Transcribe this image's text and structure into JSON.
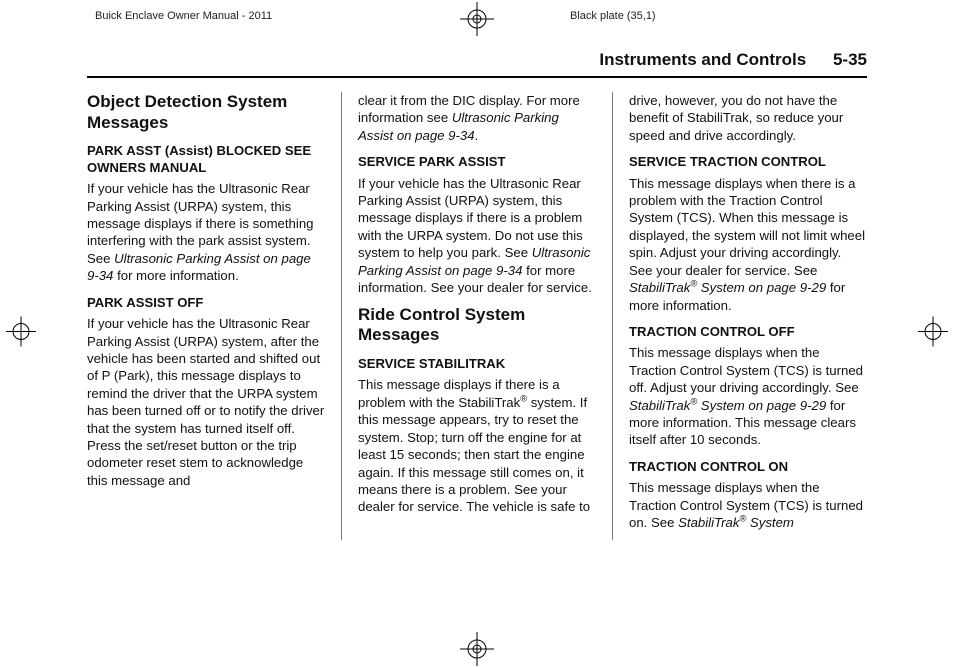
{
  "meta": {
    "manual": "Buick Enclave Owner Manual - 2011",
    "plate": "Black plate (35,1)"
  },
  "header": {
    "chapter": "Instruments and Controls",
    "page": "5-35"
  },
  "col1": {
    "h_object": "Object Detection System Messages",
    "m1_title": "PARK ASST (Assist) BLOCKED SEE OWNERS MANUAL",
    "m1_p_a": "If your vehicle has the Ultrasonic Rear Parking Assist (URPA) system, this message displays if there is something interfering with the park assist system. See ",
    "m1_ref": "Ultrasonic Parking Assist on page 9‑34",
    "m1_p_b": " for more information.",
    "m2_title": "PARK ASSIST OFF",
    "m2_p": "If your vehicle has the Ultrasonic Rear Parking Assist (URPA) system, after the vehicle has been started and shifted out of P (Park), this message displays to remind the driver that the URPA system has been turned off or to notify the driver that the system has turned itself off. Press the set/reset button or the trip odometer reset stem to acknowledge this message and"
  },
  "col2": {
    "cont_a": "clear it from the DIC display. For more information see ",
    "cont_ref": "Ultrasonic Parking Assist on page 9‑34",
    "cont_b": ".",
    "m3_title": "SERVICE PARK ASSIST",
    "m3_p_a": "If your vehicle has the Ultrasonic Rear Parking Assist (URPA) system, this message displays if there is a problem with the URPA system. Do not use this system to help you park. See ",
    "m3_ref": "Ultrasonic Parking Assist on page 9‑34",
    "m3_p_b": " for more information. See your dealer for service.",
    "h_ride": "Ride Control System Messages",
    "m4_title": "SERVICE STABILITRAK",
    "m4_p_a": "This message displays if there is a problem with the StabiliTrak",
    "m4_reg": "®",
    "m4_p_b": " system. If this message appears, try to reset the system. Stop; turn off the engine for at least 15 seconds; then start the engine again. If this message still comes on, it means there is a problem. See your dealer for service. The vehicle is safe to"
  },
  "col3": {
    "cont": "drive, however, you do not have the benefit of StabiliTrak, so reduce your speed and drive accordingly.",
    "m5_title": "SERVICE TRACTION CONTROL",
    "m5_p_a": "This message displays when there is a problem with the Traction Control System (TCS). When this message is displayed, the system will not limit wheel spin. Adjust your driving accordingly. See your dealer for service. See ",
    "m5_ref": "StabiliTrak",
    "m5_reg": "®",
    "m5_ref2": " System on page 9‑29",
    "m5_p_b": " for more information.",
    "m6_title": "TRACTION CONTROL OFF",
    "m6_p_a": "This message displays when the Traction Control System (TCS) is turned off. Adjust your driving accordingly. See ",
    "m6_ref": "StabiliTrak",
    "m6_reg": "®",
    "m6_ref2": " System on page 9‑29",
    "m6_p_b": " for more information. This message clears itself after 10 seconds.",
    "m7_title": "TRACTION CONTROL ON",
    "m7_p_a": "This message displays when the Traction Control System (TCS) is turned on. See ",
    "m7_ref": "StabiliTrak",
    "m7_reg": "®",
    "m7_ref2": " System"
  }
}
